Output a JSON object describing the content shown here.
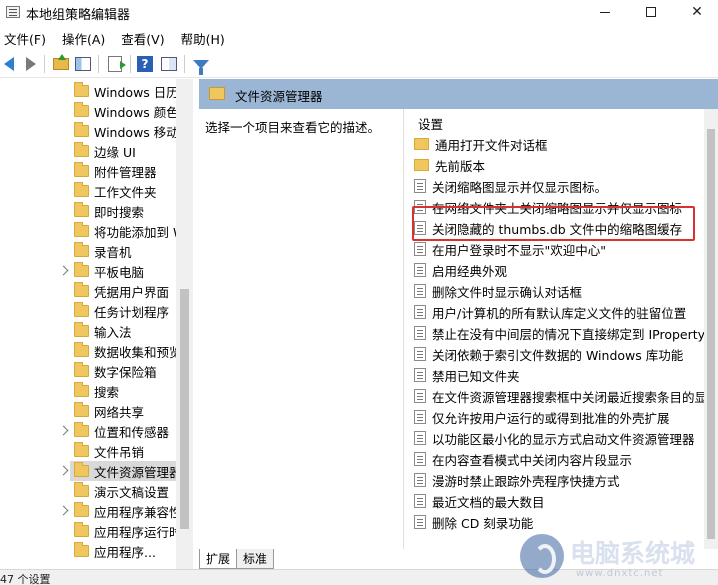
{
  "window": {
    "title": "本地组策略编辑器"
  },
  "menu": [
    {
      "label": "文件(F)"
    },
    {
      "label": "操作(A)"
    },
    {
      "label": "查看(V)"
    },
    {
      "label": "帮助(H)"
    }
  ],
  "tree": {
    "items": [
      {
        "label": "Windows 日历",
        "expandable": false
      },
      {
        "label": "Windows 颜色",
        "expandable": false
      },
      {
        "label": "Windows 移动",
        "expandable": false
      },
      {
        "label": "边缘 UI",
        "expandable": false
      },
      {
        "label": "附件管理器",
        "expandable": false
      },
      {
        "label": "工作文件夹",
        "expandable": false
      },
      {
        "label": "即时搜索",
        "expandable": false
      },
      {
        "label": "将功能添加到 W",
        "expandable": false
      },
      {
        "label": "录音机",
        "expandable": false
      },
      {
        "label": "平板电脑",
        "expandable": true
      },
      {
        "label": "凭据用户界面",
        "expandable": false
      },
      {
        "label": "任务计划程序",
        "expandable": false
      },
      {
        "label": "输入法",
        "expandable": false
      },
      {
        "label": "数据收集和预览",
        "expandable": false
      },
      {
        "label": "数字保险箱",
        "expandable": false
      },
      {
        "label": "搜索",
        "expandable": false
      },
      {
        "label": "网络共享",
        "expandable": false
      },
      {
        "label": "位置和传感器",
        "expandable": true
      },
      {
        "label": "文件吊销",
        "expandable": false
      },
      {
        "label": "文件资源管理器",
        "expandable": true,
        "selected": true
      },
      {
        "label": "演示文稿设置",
        "expandable": false
      },
      {
        "label": "应用程序兼容性",
        "expandable": true
      },
      {
        "label": "应用程序运行时",
        "expandable": false
      },
      {
        "label": "应用程序...",
        "expandable": false
      }
    ]
  },
  "detail": {
    "header_title": "文件资源管理器",
    "description": "选择一个项目来查看它的描述。",
    "list_header": "设置",
    "rows": [
      {
        "type": "folder",
        "label": "通用打开文件对话框"
      },
      {
        "type": "folder",
        "label": "先前版本"
      },
      {
        "type": "policy",
        "label": "关闭缩略图显示并仅显示图标。"
      },
      {
        "type": "policy",
        "label": "在网络文件夹上关闭缩略图显示并仅显示图标"
      },
      {
        "type": "policy",
        "label": "关闭隐藏的 thumbs.db 文件中的缩略图缓存"
      },
      {
        "type": "policy",
        "label": "在用户登录时不显示\"欢迎中心\""
      },
      {
        "type": "policy",
        "label": "启用经典外观"
      },
      {
        "type": "policy",
        "label": "删除文件时显示确认对话框"
      },
      {
        "type": "policy",
        "label": "用户/计算机的所有默认库定义文件的驻留位置"
      },
      {
        "type": "policy",
        "label": "禁止在没有中间层的情况下直接绑定到 IPropertyS"
      },
      {
        "type": "policy",
        "label": "关闭依赖于索引文件数据的 Windows 库功能"
      },
      {
        "type": "policy",
        "label": "禁用已知文件夹"
      },
      {
        "type": "policy",
        "label": "在文件资源管理器搜索框中关闭最近搜索条目的显示"
      },
      {
        "type": "policy",
        "label": "仅允许按用户运行的或得到批准的外壳扩展"
      },
      {
        "type": "policy",
        "label": "以功能区最小化的显示方式启动文件资源管理器"
      },
      {
        "type": "policy",
        "label": "在内容查看模式中关闭内容片段显示"
      },
      {
        "type": "policy",
        "label": "漫游时禁止跟踪外壳程序快捷方式"
      },
      {
        "type": "policy",
        "label": "最近文档的最大数目"
      },
      {
        "type": "policy",
        "label": "删除 CD 刻录功能"
      }
    ],
    "highlighted_row": "关闭隐藏的 thumbs.db 文件中的缩略图缓存",
    "highlight_color": "#d9322e"
  },
  "tabs": [
    {
      "label": "扩展"
    },
    {
      "label": "标准"
    }
  ],
  "status": {
    "text": "47 个设置"
  },
  "watermark": {
    "text": "电脑系统城",
    "sub": "www.dnxtc.net"
  },
  "colors": {
    "header_bg": "#9ab6d4",
    "selected_bg": "#d9d9d9"
  }
}
